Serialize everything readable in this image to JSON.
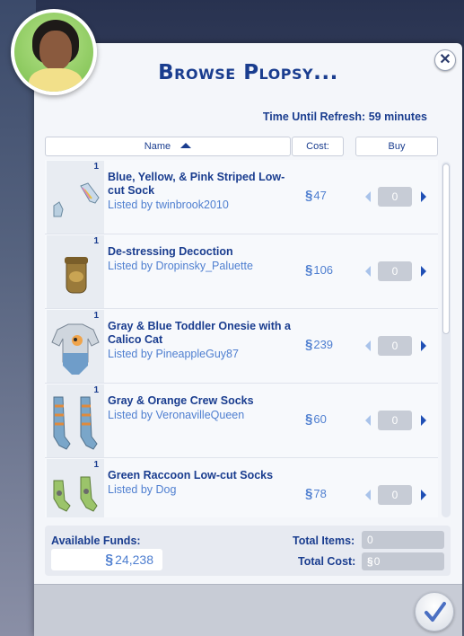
{
  "dialog": {
    "title": "Browse Plopsy...",
    "refresh_text": "Time Until Refresh: 59 minutes"
  },
  "table": {
    "headers": {
      "name": "Name",
      "cost": "Cost:",
      "buy": "Buy"
    },
    "sort": "name-ascending"
  },
  "currency_symbol": "§",
  "items": [
    {
      "qty": "1",
      "name": "Blue, Yellow, & Pink Striped Low-cut Sock",
      "seller": "Listed by twinbrook2010",
      "cost": "47",
      "buy_qty": "0",
      "thumb_icon": "socks-icon"
    },
    {
      "qty": "1",
      "name": "De-stressing Decoction",
      "seller": "Listed by Dropinsky_Paluette",
      "cost": "106",
      "buy_qty": "0",
      "thumb_icon": "jar-icon"
    },
    {
      "qty": "1",
      "name": "Gray & Blue Toddler Onesie with a Calico Cat",
      "seller": "Listed by PineappleGuy87",
      "cost": "239",
      "buy_qty": "0",
      "thumb_icon": "onesie-icon"
    },
    {
      "qty": "1",
      "name": "Gray & Orange Crew Socks",
      "seller": "Listed by VeronavilleQueen",
      "cost": "60",
      "buy_qty": "0",
      "thumb_icon": "crew-socks-icon"
    },
    {
      "qty": "1",
      "name": "Green Raccoon Low-cut Socks",
      "seller": "Listed by Dog",
      "cost": "78",
      "buy_qty": "0",
      "thumb_icon": "socks-icon"
    }
  ],
  "totals": {
    "funds_label": "Available Funds:",
    "funds_value": "24,238",
    "items_label": "Total Items:",
    "items_value": "0",
    "cost_label": "Total Cost:",
    "cost_value": "0"
  },
  "colors": {
    "accent": "#1a3d8f",
    "link": "#4f7fd0",
    "confirm_check": "#4a6fc2"
  }
}
